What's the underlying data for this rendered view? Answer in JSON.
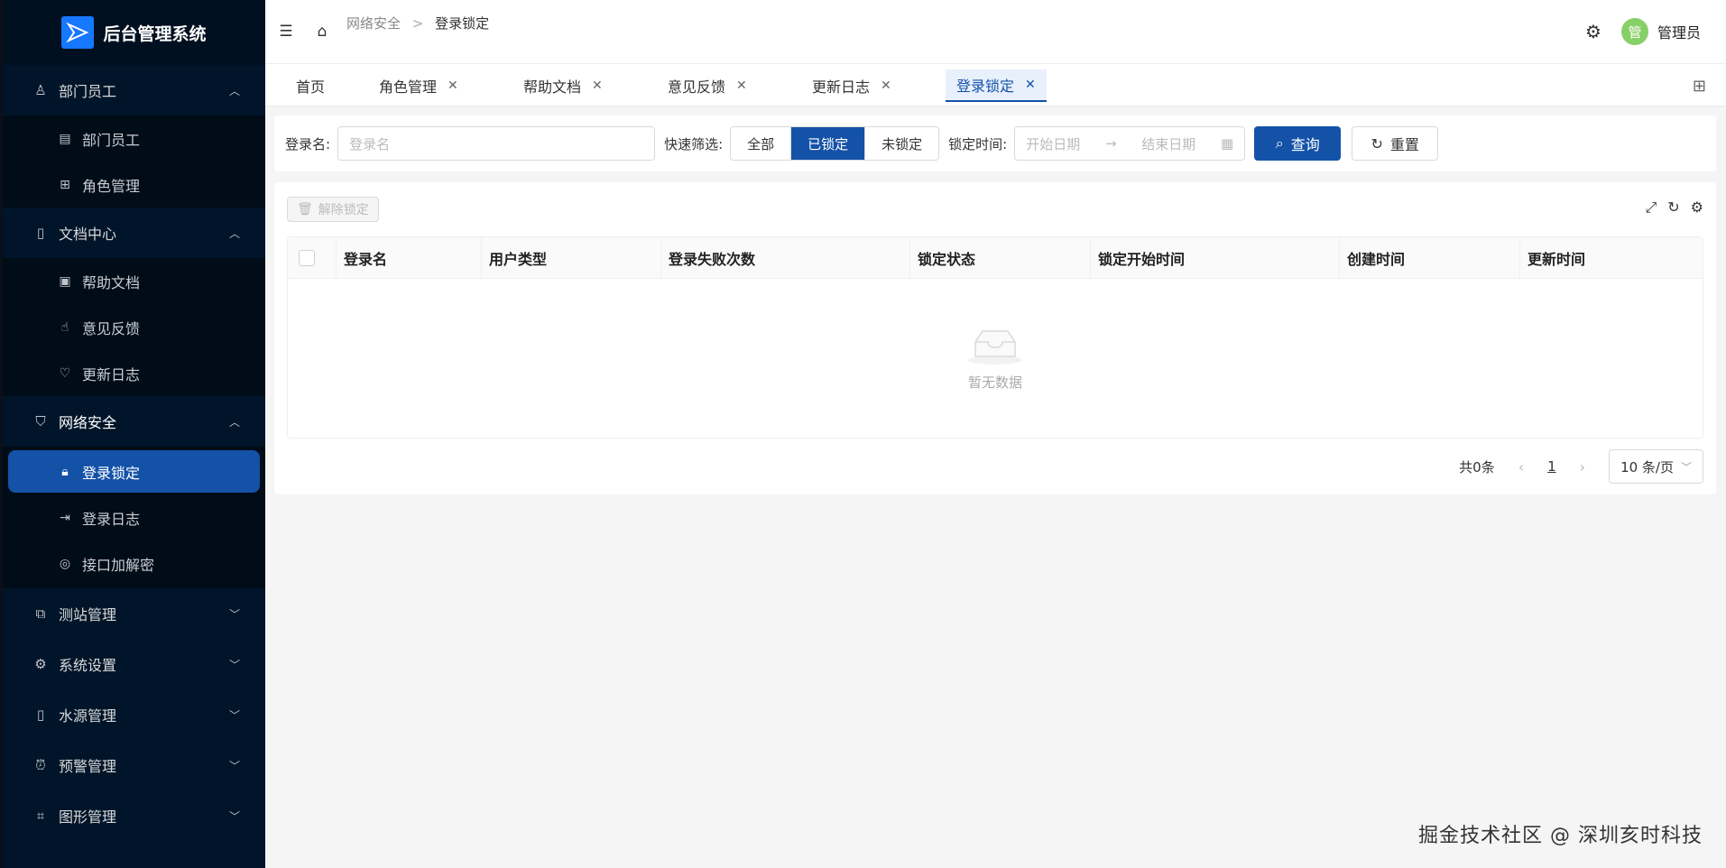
{
  "app": {
    "title": "后台管理系统"
  },
  "sidebar": {
    "groups": [
      {
        "label": "部门员工",
        "expanded": true,
        "items": [
          {
            "label": "部门员工"
          },
          {
            "label": "角色管理"
          }
        ]
      },
      {
        "label": "文档中心",
        "expanded": true,
        "items": [
          {
            "label": "帮助文档"
          },
          {
            "label": "意见反馈"
          },
          {
            "label": "更新日志"
          }
        ]
      },
      {
        "label": "网络安全",
        "expanded": true,
        "items": [
          {
            "label": "登录锁定",
            "active": true
          },
          {
            "label": "登录日志"
          },
          {
            "label": "接口加解密"
          }
        ]
      },
      {
        "label": "测站管理",
        "expanded": false
      },
      {
        "label": "系统设置",
        "expanded": false
      },
      {
        "label": "水源管理",
        "expanded": false
      },
      {
        "label": "预警管理",
        "expanded": false
      },
      {
        "label": "图形管理",
        "expanded": false
      }
    ]
  },
  "header": {
    "breadcrumb": [
      "网络安全",
      "登录锁定"
    ],
    "breadcrumb_sep": ">",
    "user": {
      "avatar": "管",
      "name": "管理员"
    }
  },
  "tabs": [
    {
      "label": "首页",
      "closable": false
    },
    {
      "label": "角色管理",
      "closable": true
    },
    {
      "label": "帮助文档",
      "closable": true
    },
    {
      "label": "意见反馈",
      "closable": true
    },
    {
      "label": "更新日志",
      "closable": true
    },
    {
      "label": "登录锁定",
      "closable": true,
      "active": true
    }
  ],
  "filter": {
    "login_label": "登录名:",
    "login_placeholder": "登录名",
    "quick_label": "快速筛选:",
    "quick_options": [
      "全部",
      "已锁定",
      "未锁定"
    ],
    "quick_selected": "已锁定",
    "lock_time_label": "锁定时间:",
    "start_placeholder": "开始日期",
    "end_placeholder": "结束日期",
    "search_label": "查询",
    "reset_label": "重置"
  },
  "table": {
    "unlock_label": "解除锁定",
    "columns": [
      "登录名",
      "用户类型",
      "登录失败次数",
      "锁定状态",
      "锁定开始时间",
      "创建时间",
      "更新时间"
    ],
    "rows": [],
    "empty_text": "暂无数据"
  },
  "pagination": {
    "total_text": "共0条",
    "current_page": "1",
    "page_size": "10 条/页"
  },
  "footer": {
    "text": "掘金技术社区 @ 深圳亥时科技"
  },
  "colors": {
    "primary": "#1452a8",
    "sidebar_bg": "#001529"
  }
}
